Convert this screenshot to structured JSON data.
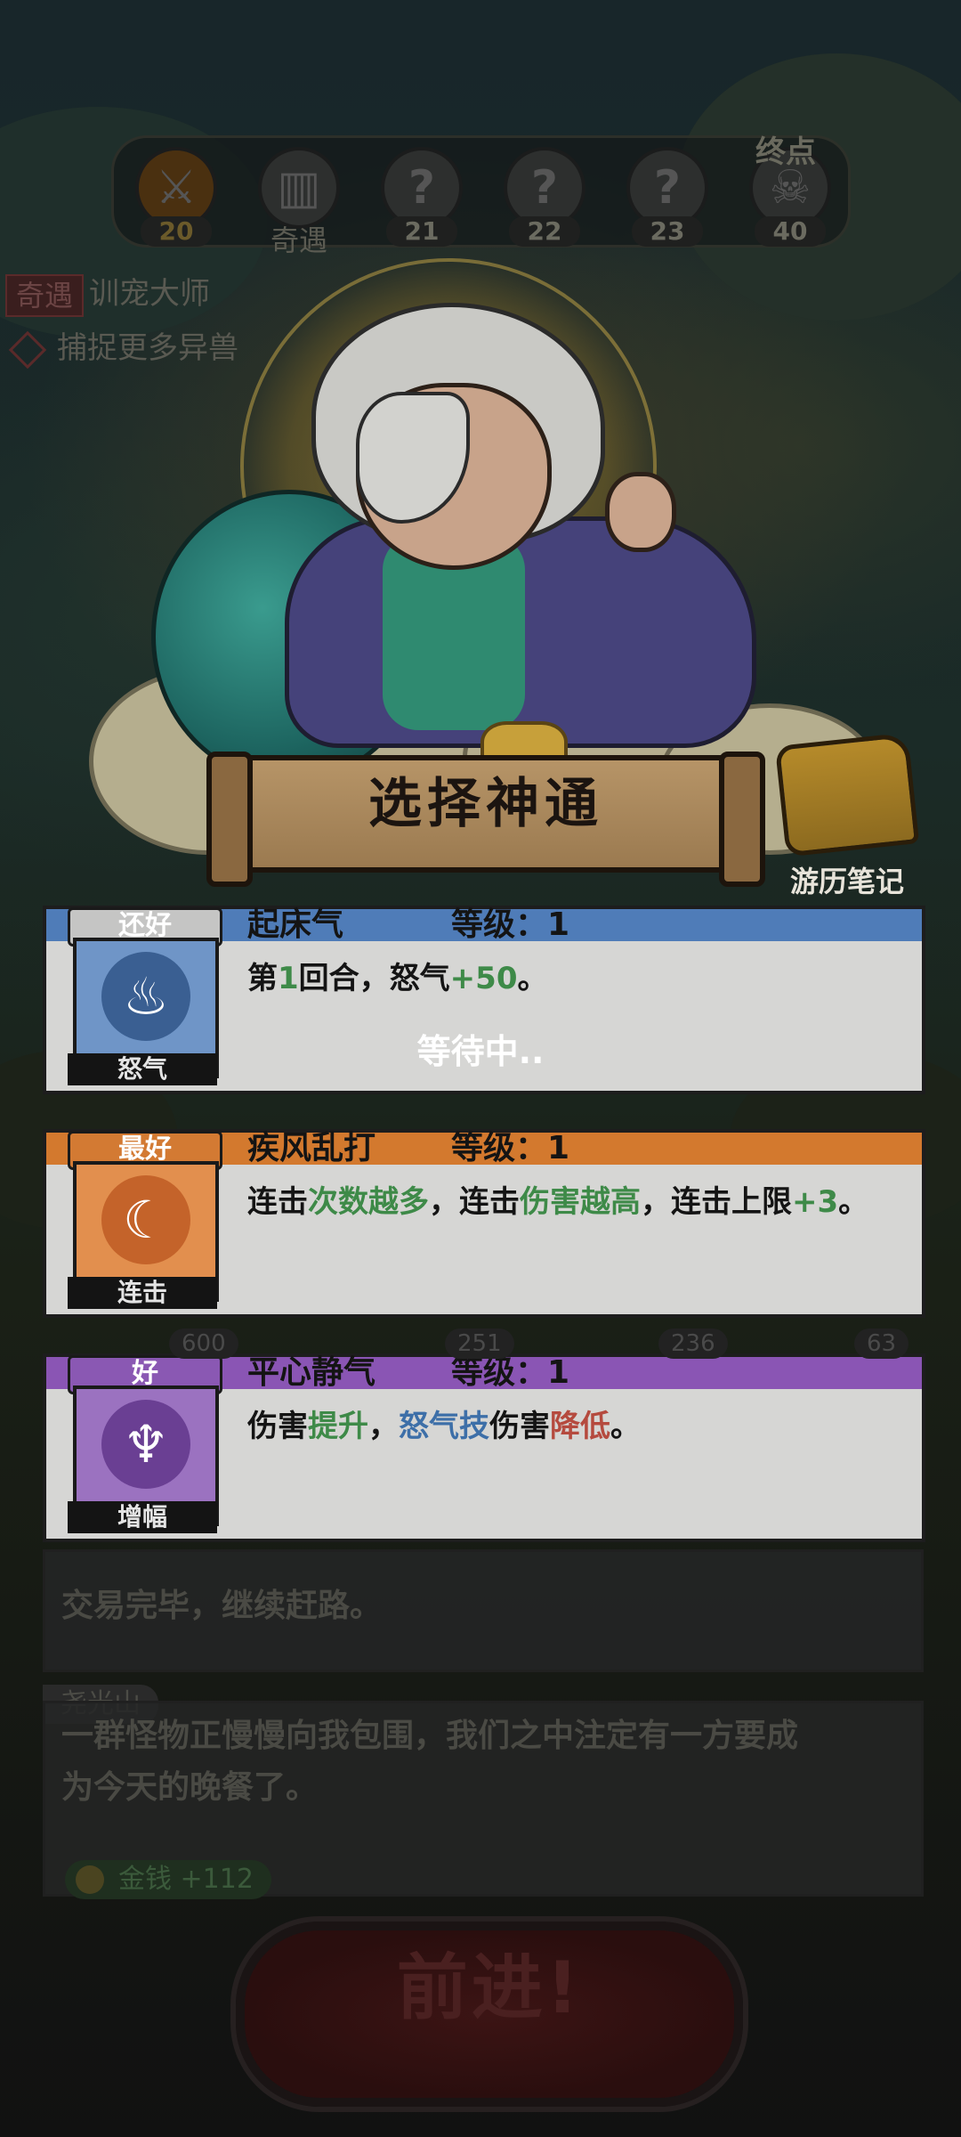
{
  "top_progress": {
    "stages": [
      {
        "icon": "swords-icon",
        "number": "20",
        "current": true
      },
      {
        "icon": "book-icon",
        "label": "奇遇"
      },
      {
        "icon": "question-icon",
        "number": "21"
      },
      {
        "icon": "question-icon",
        "number": "22"
      },
      {
        "icon": "question-icon",
        "number": "23"
      },
      {
        "icon": "skull-icon",
        "number": "40"
      }
    ],
    "end_label": "终点"
  },
  "quest": {
    "tag": "奇遇",
    "title": "训宠大师",
    "goal": "捕捉更多异兽"
  },
  "selection": {
    "title": "选择神通",
    "journal_label": "游历笔记",
    "waiting_text": "等待中.."
  },
  "cards": [
    {
      "rank": "还好",
      "type": "怒气",
      "name": "起床气",
      "level": "等级：1",
      "color": "#4f7cb8",
      "desc": [
        {
          "t": "第",
          "c": ""
        },
        {
          "t": "1",
          "c": "g"
        },
        {
          "t": "回合，怒气",
          "c": ""
        },
        {
          "t": "+50",
          "c": "g"
        },
        {
          "t": "。",
          "c": ""
        }
      ]
    },
    {
      "rank": "最好",
      "type": "连击",
      "name": "疾风乱打",
      "level": "等级：1",
      "color": "#d3792e",
      "desc": [
        {
          "t": "连击",
          "c": ""
        },
        {
          "t": "次数越多",
          "c": "g"
        },
        {
          "t": "，连击",
          "c": ""
        },
        {
          "t": "伤害越高",
          "c": "g"
        },
        {
          "t": "，连击上限",
          "c": ""
        },
        {
          "t": "+3",
          "c": "g"
        },
        {
          "t": "。",
          "c": ""
        }
      ]
    },
    {
      "rank": "好",
      "type": "增幅",
      "name": "平心静气",
      "level": "等级：1",
      "color": "#8a55b4",
      "desc": [
        {
          "t": "伤害",
          "c": ""
        },
        {
          "t": "提升",
          "c": "g"
        },
        {
          "t": "，",
          "c": ""
        },
        {
          "t": "怒气技",
          "c": "b"
        },
        {
          "t": "伤害",
          "c": ""
        },
        {
          "t": "降低",
          "c": "r"
        },
        {
          "t": "。",
          "c": ""
        }
      ]
    }
  ],
  "stats": [
    "600",
    "251",
    "236",
    "63"
  ],
  "log": {
    "trade_text": "交易完毕，继续赶路。",
    "location": "尧光山",
    "encounter_text_line1": "一群怪物正慢慢向我包围，我们之中注定有一方要成",
    "encounter_text_line2": "为今天的晚餐了。",
    "reward": "金钱 +112"
  },
  "go_button": "前进!"
}
